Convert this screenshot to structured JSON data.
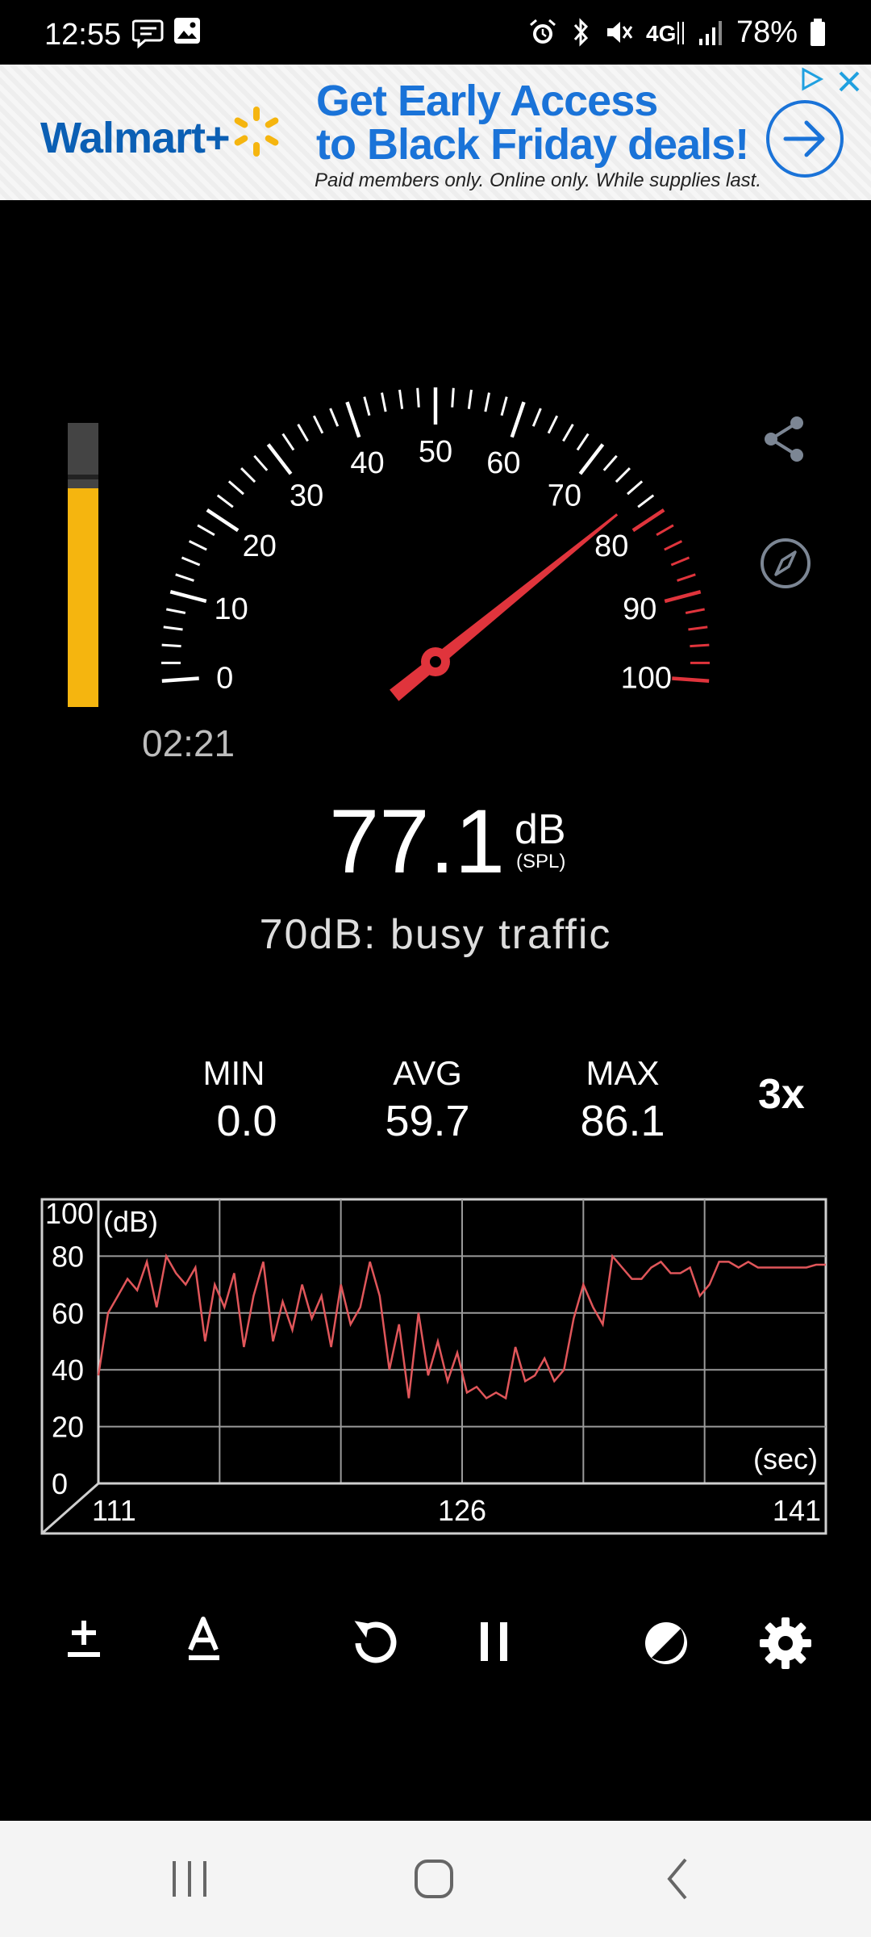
{
  "status_bar": {
    "time": "12:55",
    "battery": "78%",
    "network": "4G"
  },
  "ad": {
    "brand": "Walmart+",
    "headline_line1": "Get Early Access",
    "headline_line2": "to Black Friday deals!",
    "fineprint": "Paid members only. Online only. While supplies last."
  },
  "meter": {
    "elapsed": "02:21",
    "current_db": 77.1,
    "current_value": "77.1",
    "unit": "dB",
    "unit_sub": "(SPL)",
    "reference": "70dB: busy traffic",
    "level_fraction": 0.77,
    "peak_fraction": 0.8
  },
  "gauge": {
    "min": 0,
    "max": 100,
    "needle_value": 77.1,
    "red_zone_start": 80,
    "labels": [
      "0",
      "10",
      "20",
      "30",
      "40",
      "50",
      "60",
      "70",
      "80",
      "90",
      "100"
    ],
    "scale_color": "#ffffff",
    "red_color": "#e0343c"
  },
  "stats": {
    "min_label": "MIN",
    "min_value": "0.0",
    "avg_label": "AVG",
    "avg_value": "59.7",
    "max_label": "MAX",
    "max_value": "86.1",
    "zoom_label": "3x"
  },
  "chart_data": {
    "type": "line",
    "y_unit_label": "(dB)",
    "x_unit_label": "(sec)",
    "ylim": [
      0,
      100
    ],
    "xlim": [
      111,
      141
    ],
    "y_ticks": [
      "0",
      "20",
      "40",
      "60",
      "80",
      "100"
    ],
    "x_ticks": [
      "111",
      "126",
      "141"
    ],
    "grid": true,
    "line_color": "#e0565a",
    "series": [
      {
        "x": [
          111.0,
          111.4,
          111.8,
          112.2,
          112.6,
          113.0,
          113.4,
          113.8,
          114.2,
          114.6,
          115.0,
          115.4,
          115.8,
          116.2,
          116.6,
          117.0,
          117.4,
          117.8,
          118.2,
          118.6,
          119.0,
          119.4,
          119.8,
          120.2,
          120.6,
          121.0,
          121.4,
          121.8,
          122.2,
          122.6,
          123.0,
          123.4,
          123.8,
          124.2,
          124.6,
          125.0,
          125.4,
          125.8,
          126.2,
          126.6,
          127.0,
          127.4,
          127.8,
          128.2,
          128.6,
          129.0,
          129.4,
          129.8,
          130.2,
          130.6,
          131.0,
          131.4,
          131.8,
          132.2,
          132.6,
          133.0,
          133.4,
          133.8,
          134.2,
          134.6,
          135.0,
          135.4,
          135.8,
          136.2,
          136.6,
          137.0,
          137.4,
          137.8,
          138.2,
          138.6,
          139.0,
          139.4,
          139.8,
          140.2,
          140.6,
          141.0
        ],
        "y": [
          38,
          60,
          66,
          72,
          68,
          78,
          62,
          80,
          74,
          70,
          76,
          50,
          70,
          62,
          74,
          48,
          66,
          78,
          50,
          64,
          54,
          70,
          58,
          66,
          48,
          70,
          56,
          62,
          78,
          66,
          40,
          56,
          30,
          60,
          38,
          50,
          36,
          46,
          32,
          34,
          30,
          32,
          30,
          48,
          36,
          38,
          44,
          36,
          40,
          58,
          70,
          62,
          56,
          80,
          76,
          72,
          72,
          76,
          78,
          74,
          74,
          76,
          66,
          70,
          78,
          78,
          76,
          78,
          76,
          76,
          76,
          76,
          76,
          76,
          77,
          77
        ]
      }
    ]
  }
}
